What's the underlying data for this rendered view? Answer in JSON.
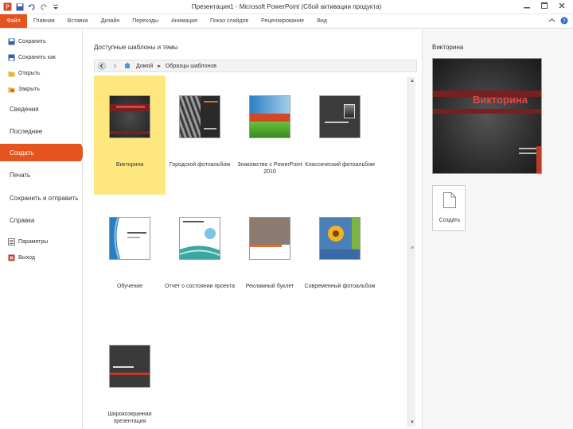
{
  "window": {
    "title": "Презентация1  -  Microsoft PowerPoint (Сбой активации продукта)"
  },
  "ribbon": {
    "file_tab": "Файл",
    "tabs": [
      "Главная",
      "Вставка",
      "Дизайн",
      "Переходы",
      "Анимация",
      "Показ слайдов",
      "Рецензирование",
      "Вид"
    ]
  },
  "nav": {
    "save": "Сохранить",
    "save_as": "Сохранить как",
    "open": "Открыть",
    "close": "Закрыть",
    "info": "Сведения",
    "recent": "Последние",
    "new": "Создать",
    "print": "Печать",
    "save_send": "Сохранить и отправить",
    "help": "Справка",
    "options": "Параметры",
    "exit": "Выход"
  },
  "main": {
    "section_title": "Доступные шаблоны и темы",
    "breadcrumb": {
      "home": "Домой",
      "current": "Образцы шаблонов"
    },
    "templates": [
      {
        "label": "Викторина"
      },
      {
        "label": "Городской фотоальбом"
      },
      {
        "label": "Знакомство с PowerPoint 2010"
      },
      {
        "label": "Классический фотоальбом"
      },
      {
        "label": "Обучение"
      },
      {
        "label": "Отчет о состоянии проекта"
      },
      {
        "label": "Рекламный буклет"
      },
      {
        "label": "Современный фотоальбом"
      },
      {
        "label": "Широкоэкранная презентация"
      }
    ]
  },
  "preview": {
    "title": "Викторина",
    "slide_title": "Викторина",
    "create_label": "Создать"
  },
  "colors": {
    "accent": "#e5531e",
    "selected_tile": "#ffe780"
  }
}
